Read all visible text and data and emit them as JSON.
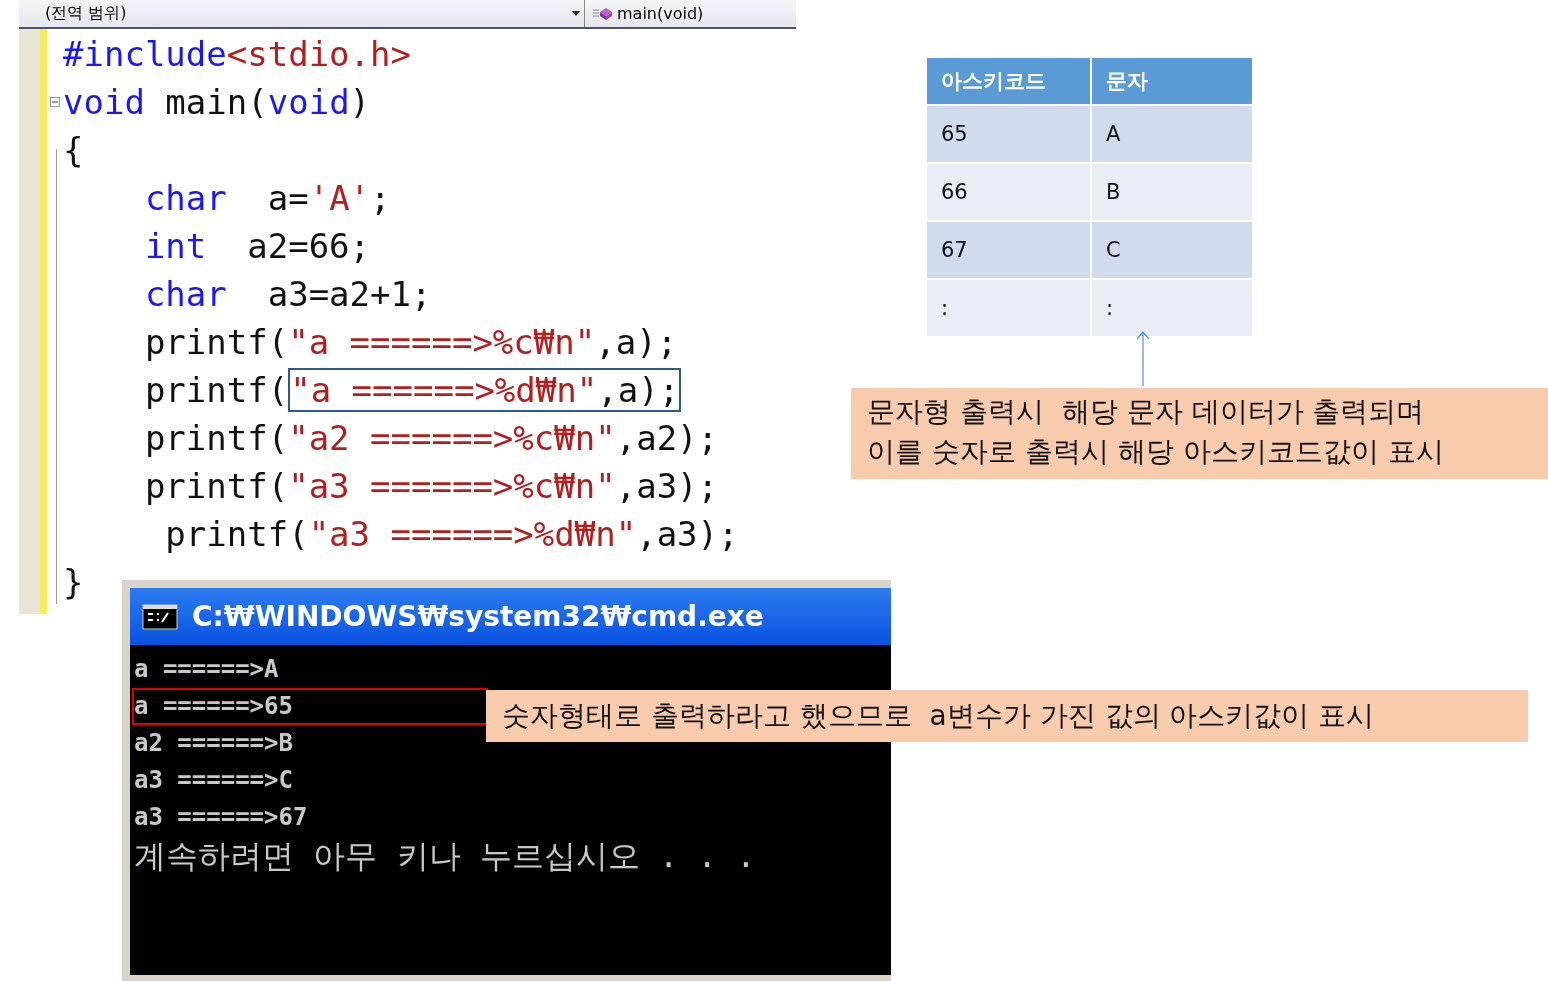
{
  "editor": {
    "scope_dropdown": "(전역 범위)",
    "member_dropdown": "main(void)",
    "lines": [
      {
        "collapsible": false,
        "tokens": [
          {
            "kind": "kw",
            "text": "#include"
          },
          {
            "kind": "str",
            "text": "<stdio.h>"
          }
        ]
      },
      {
        "collapsible": true,
        "tokens": [
          {
            "kind": "kw",
            "text": "void"
          },
          {
            "kind": "plain",
            "text": " main("
          },
          {
            "kind": "kw",
            "text": "void"
          },
          {
            "kind": "plain",
            "text": ")"
          }
        ]
      },
      {
        "collapsible": false,
        "tokens": [
          {
            "kind": "plain",
            "text": "{"
          }
        ]
      },
      {
        "collapsible": false,
        "tokens": [
          {
            "kind": "kw",
            "text": "    char"
          },
          {
            "kind": "plain",
            "text": "  a="
          },
          {
            "kind": "str",
            "text": "'A'"
          },
          {
            "kind": "plain",
            "text": ";"
          }
        ]
      },
      {
        "collapsible": false,
        "tokens": [
          {
            "kind": "kw",
            "text": "    int"
          },
          {
            "kind": "plain",
            "text": "  a2=66;"
          }
        ]
      },
      {
        "collapsible": false,
        "tokens": [
          {
            "kind": "kw",
            "text": "    char"
          },
          {
            "kind": "plain",
            "text": "  a3=a2+1;"
          }
        ]
      },
      {
        "collapsible": false,
        "tokens": [
          {
            "kind": "plain",
            "text": "    printf("
          },
          {
            "kind": "str",
            "text": "\"a ======>%c₩n\""
          },
          {
            "kind": "plain",
            "text": ",a);"
          }
        ]
      },
      {
        "collapsible": false,
        "tokens": [
          {
            "kind": "plain",
            "text": "    printf("
          }
        ],
        "boxed_tokens": [
          {
            "kind": "str",
            "text": "\"a ======>%d₩n\""
          },
          {
            "kind": "plain",
            "text": ",a);"
          }
        ]
      },
      {
        "collapsible": false,
        "tokens": [
          {
            "kind": "plain",
            "text": "    printf("
          },
          {
            "kind": "str",
            "text": "\"a2 ======>%c₩n\""
          },
          {
            "kind": "plain",
            "text": ",a2);"
          }
        ]
      },
      {
        "collapsible": false,
        "tokens": [
          {
            "kind": "plain",
            "text": "    printf("
          },
          {
            "kind": "str",
            "text": "\"a3 ======>%c₩n\""
          },
          {
            "kind": "plain",
            "text": ",a3);"
          }
        ]
      },
      {
        "collapsible": false,
        "tokens": [
          {
            "kind": "plain",
            "text": "     printf("
          },
          {
            "kind": "str",
            "text": "\"a3 ======>%d₩n\""
          },
          {
            "kind": "plain",
            "text": ",a3);"
          }
        ]
      },
      {
        "collapsible": false,
        "tokens": [
          {
            "kind": "plain",
            "text": "}"
          }
        ]
      }
    ]
  },
  "console": {
    "title": "C:₩WINDOWS₩system32₩cmd.exe",
    "lines": [
      {
        "text": "a ======>A",
        "highlighted": false
      },
      {
        "text": "a ======>65",
        "highlighted": true
      },
      {
        "text": "a2 ======>B",
        "highlighted": false
      },
      {
        "text": "a3 ======>C",
        "highlighted": false
      },
      {
        "text": "a3 ======>67",
        "highlighted": false
      }
    ],
    "prompt": "계속하려면 아무 키나 누르십시오 . . ."
  },
  "table": {
    "columns": [
      "아스키코드",
      "문자"
    ],
    "rows": [
      [
        "65",
        "A"
      ],
      [
        "66",
        "B"
      ],
      [
        "67",
        "C"
      ],
      [
        ":",
        ":"
      ]
    ]
  },
  "notes": [
    "문자형 출력시  해당 문자 데이터가 출력되며\n이를 숫자로 출력시 해당 아스키코드값이 표시",
    "숫자형태로 출력하라고 했으므로  a변수가 가진 값의 아스키값이 표시"
  ]
}
